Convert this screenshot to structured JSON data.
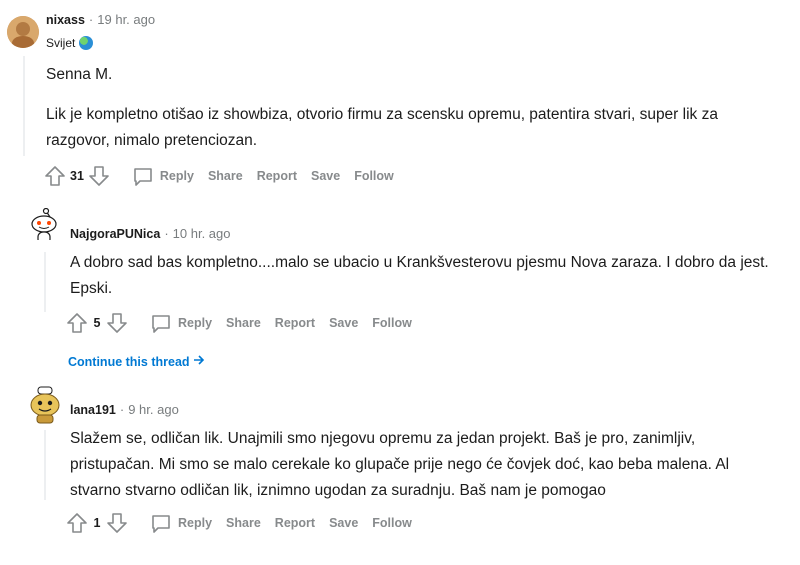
{
  "comments": [
    {
      "author": "nixass",
      "time": "19 hr. ago",
      "flair": "Svijet",
      "paragraphs": [
        "Senna M.",
        "Lik je kompletno otišao iz showbiza, otvorio firmu za scensku opremu, patentira stvari, super lik za razgovor, nimalo pretenciozan."
      ],
      "votes": "31",
      "actions": {
        "reply": "Reply",
        "share": "Share",
        "report": "Report",
        "save": "Save",
        "follow": "Follow"
      }
    },
    {
      "author": "NajgoraPUNica",
      "time": "10 hr. ago",
      "paragraphs": [
        "A dobro sad bas kompletno....malo se ubacio u Krankšvesterovu pjesmu Nova zaraza. I dobro da jest. Epski."
      ],
      "votes": "5",
      "actions": {
        "reply": "Reply",
        "share": "Share",
        "report": "Report",
        "save": "Save",
        "follow": "Follow"
      },
      "continue_label": "Continue this thread"
    },
    {
      "author": "lana191",
      "time": "9 hr. ago",
      "paragraphs": [
        "Slažem se, odličan lik. Unajmili smo njegovu opremu za jedan projekt. Baš je pro, zanimljiv, pristupačan. Mi smo se malo cerekale ko glupače prije nego će čovjek doć, kao beba malena. Al stvarno stvarno odličan lik, iznimno ugodan za suradnju. Baš nam je pomogao"
      ],
      "votes": "1",
      "actions": {
        "reply": "Reply",
        "share": "Share",
        "report": "Report",
        "save": "Save",
        "follow": "Follow"
      }
    }
  ],
  "separator": "·",
  "colors": {
    "meta": "#787c7e",
    "text": "#1c1c1c",
    "action": "#878a8c",
    "link": "#0079d3"
  }
}
